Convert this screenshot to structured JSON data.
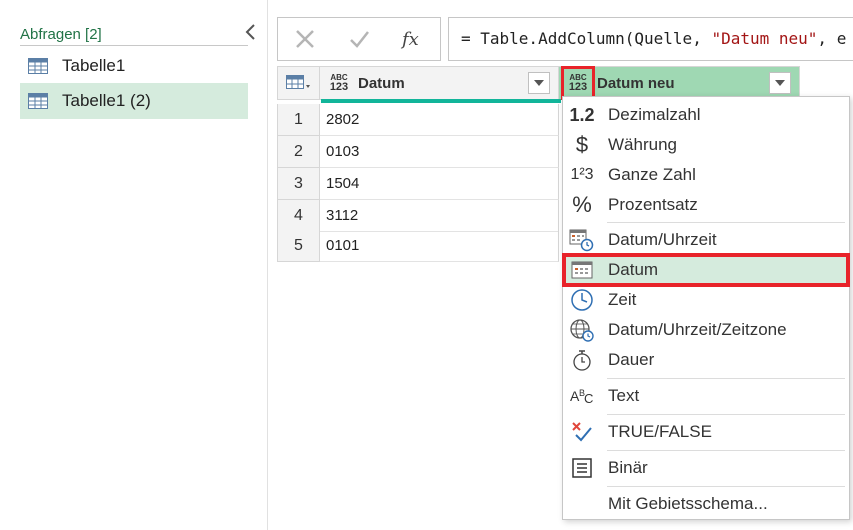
{
  "queries": {
    "header": "Abfragen [2]",
    "items": [
      {
        "label": "Tabelle1"
      },
      {
        "label": "Tabelle1 (2)"
      }
    ]
  },
  "formula_bar": {
    "prefix": "= Table.AddColumn(Quelle, ",
    "string": "\"Datum neu\"",
    "suffix": ", e"
  },
  "grid": {
    "columns": [
      {
        "type_top": "ABC",
        "type_bottom": "123",
        "title": "Datum"
      },
      {
        "type_top": "ABC",
        "type_bottom": "123",
        "title": "Datum neu"
      }
    ],
    "rows": [
      {
        "num": "1",
        "value": "2802"
      },
      {
        "num": "2",
        "value": "0103"
      },
      {
        "num": "3",
        "value": "1504"
      },
      {
        "num": "4",
        "value": "3112"
      },
      {
        "num": "5",
        "value": "0101"
      }
    ]
  },
  "type_menu": {
    "items": [
      {
        "icon": "decimal-icon",
        "label": "Dezimalzahl",
        "glyph": "1.2"
      },
      {
        "icon": "currency-icon",
        "label": "Währung",
        "glyph": "$"
      },
      {
        "icon": "whole-number-icon",
        "label": "Ganze Zahl",
        "glyph": "1²3"
      },
      {
        "icon": "percent-icon",
        "label": "Prozentsatz",
        "glyph": "%"
      },
      {
        "icon": "datetime-icon",
        "label": "Datum/Uhrzeit"
      },
      {
        "icon": "date-icon",
        "label": "Datum"
      },
      {
        "icon": "time-icon",
        "label": "Zeit"
      },
      {
        "icon": "datetimezone-icon",
        "label": "Datum/Uhrzeit/Zeitzone"
      },
      {
        "icon": "duration-icon",
        "label": "Dauer"
      },
      {
        "icon": "text-icon",
        "label": "Text"
      },
      {
        "icon": "true-false-icon",
        "label": "TRUE/FALSE"
      },
      {
        "icon": "binary-icon",
        "label": "Binär"
      },
      {
        "icon": "",
        "label": "Mit Gebietsschema..."
      }
    ]
  },
  "colors": {
    "accent_green": "#217346",
    "selected_bg": "#d5ebdd",
    "highlight_red": "#e8232a",
    "quality_bar": "#12b59a",
    "column_header_selected": "#9fd8b3"
  }
}
